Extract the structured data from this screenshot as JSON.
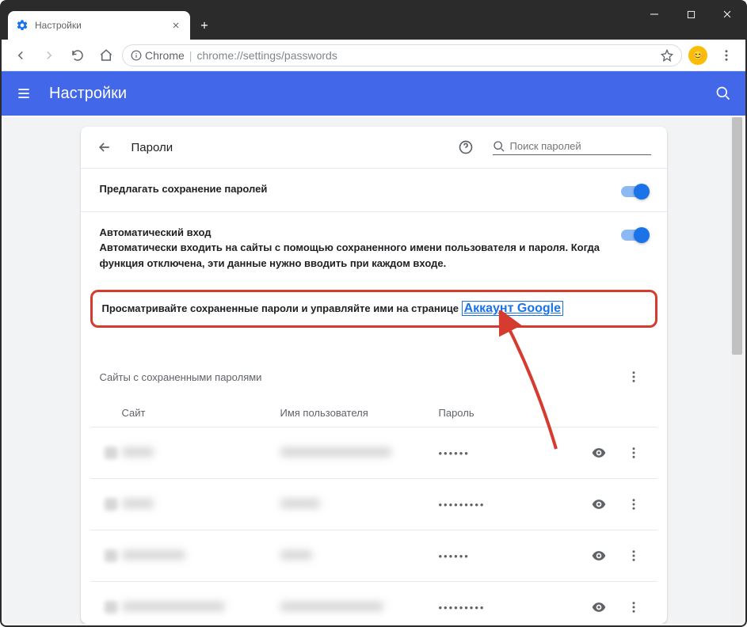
{
  "window": {
    "tab_title": "Настройки"
  },
  "omnibox": {
    "scheme_label": "Chrome",
    "url": "chrome://settings/passwords"
  },
  "app": {
    "title": "Настройки"
  },
  "page": {
    "title": "Пароли",
    "search_placeholder": "Поиск паролей"
  },
  "settings": {
    "offer_save": {
      "title": "Предлагать сохранение паролей"
    },
    "auto_signin": {
      "title": "Автоматический вход",
      "desc": "Автоматически входить на сайты с помощью сохраненного имени пользователя и пароля. Когда функция отключена, эти данные нужно вводить при каждом входе."
    },
    "manage": {
      "text": "Просматривайте сохраненные пароли и управляйте ими на странице ",
      "link": "Аккаунт Google"
    }
  },
  "saved": {
    "title": "Сайты с сохраненными паролями",
    "columns": {
      "site": "Сайт",
      "user": "Имя пользователя",
      "pass": "Пароль"
    },
    "rows": [
      {
        "site_w": 40,
        "user_w": 140,
        "pass": "••••••",
        "fav": "#d7d7d7"
      },
      {
        "site_w": 40,
        "user_w": 50,
        "pass": "•••••••••",
        "fav": "#d7d7d7"
      },
      {
        "site_w": 80,
        "user_w": 40,
        "pass": "••••••",
        "fav": "#d7d7d7"
      },
      {
        "site_w": 130,
        "user_w": 130,
        "pass": "•••••••••",
        "fav": "#d7d7d7"
      }
    ]
  }
}
